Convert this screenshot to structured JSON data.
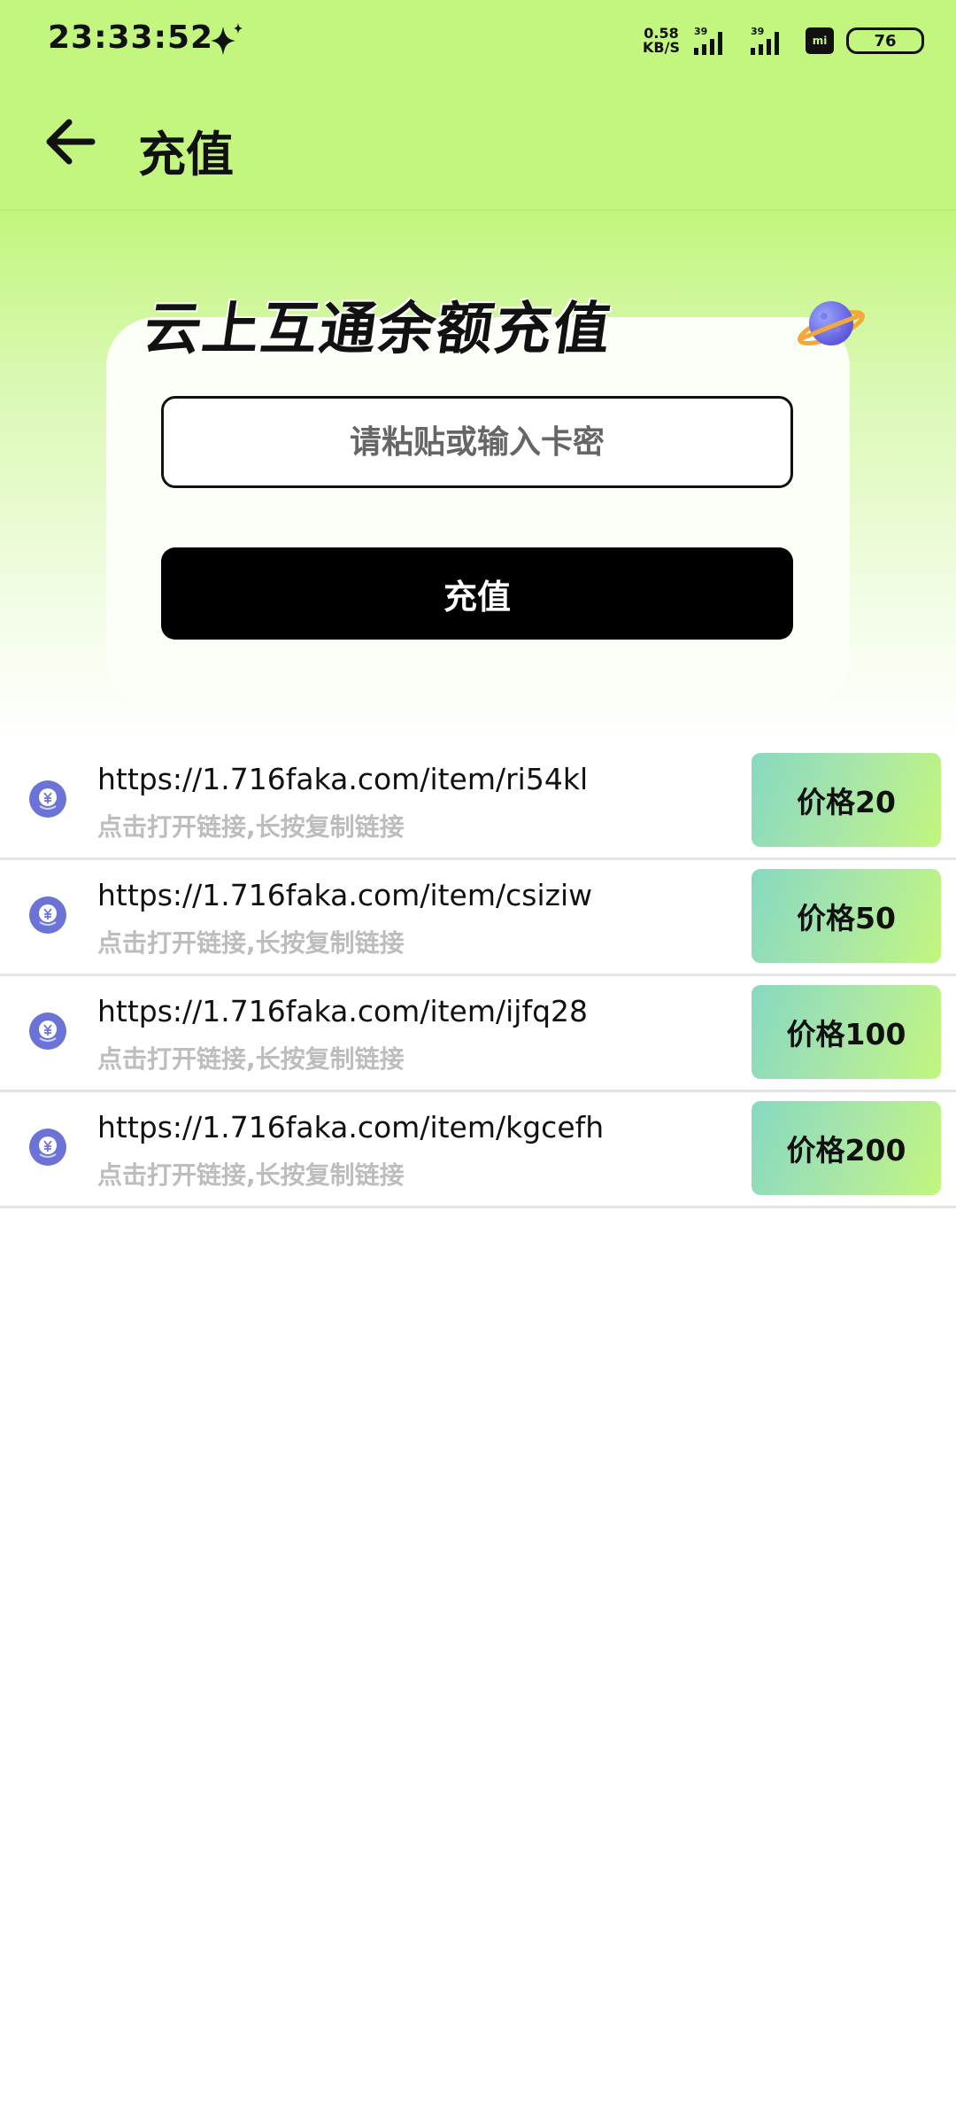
{
  "status_bar": {
    "time": "23:33:52",
    "net_speed_value": "0.58",
    "net_speed_unit": "KB/S",
    "signal1_label": "39",
    "signal2_label": "39",
    "mi_label": "mi",
    "battery": "76"
  },
  "app_bar": {
    "title": "充值"
  },
  "card": {
    "heading": "云上互通余额充值",
    "input_placeholder": "请粘贴或输入卡密",
    "button_label": "充值"
  },
  "items": [
    {
      "url": "https://1.716faka.com/item/ri54kl",
      "hint": "点击打开链接,长按复制链接",
      "price": "价格20"
    },
    {
      "url": "https://1.716faka.com/item/csiziw",
      "hint": "点击打开链接,长按复制链接",
      "price": "价格50"
    },
    {
      "url": "https://1.716faka.com/item/ijfq28",
      "hint": "点击打开链接,长按复制链接",
      "price": "价格100"
    },
    {
      "url": "https://1.716faka.com/item/kgcefh",
      "hint": "点击打开链接,长按复制链接",
      "price": "价格200"
    }
  ],
  "icons": {
    "back": "arrow-left-icon",
    "planet": "planet-icon",
    "coin": "yuan-coin-icon",
    "sparkle": "sparkle-icon"
  },
  "colors": {
    "accent_green": "#c2f67e",
    "button_black": "#000000",
    "coin_purple": "#6b74d6"
  }
}
